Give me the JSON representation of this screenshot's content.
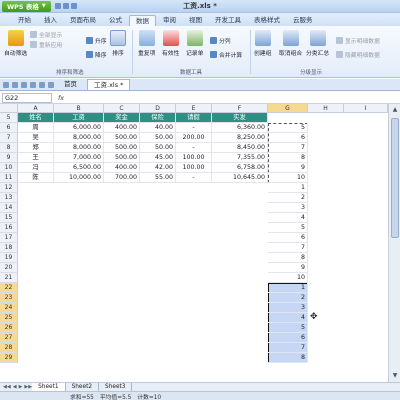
{
  "titlebar": {
    "app_button": "WPS 表格",
    "document_title": "工资.xls *"
  },
  "menu": {
    "tabs": [
      "开始",
      "插入",
      "页面布局",
      "公式",
      "数据",
      "审阅",
      "视图",
      "开发工具",
      "表格样式",
      "云服务"
    ],
    "active_index": 4
  },
  "ribbon": {
    "autofilter": "自动筛选",
    "show_all": "全部显示",
    "reapply": "重新应用",
    "sort_asc": "升序",
    "sort_desc": "降序",
    "sort": "排序",
    "highlight_dup": "重复项",
    "validity": "有效性",
    "records": "记录单",
    "split": "分列",
    "merge_calc": "合并计算",
    "create_group": "创建组",
    "ungroup": "取消组合",
    "subtotal": "分类汇总",
    "show_detail": "显示明细数据",
    "hide_detail": "隐藏明细数据",
    "group_sort_filter": "排序和筛选",
    "group_data_tools": "数据工具",
    "group_outline": "分级显示"
  },
  "doctabs": {
    "home_tab": "首页",
    "file_tab": "工资.xls *"
  },
  "formula_bar": {
    "namebox": "G22",
    "fx": "fx"
  },
  "columns": [
    "A",
    "B",
    "C",
    "D",
    "E",
    "F",
    "G",
    "H",
    "I"
  ],
  "selected_column": "G",
  "rows": {
    "numbers": [
      "5",
      "6",
      "7",
      "8",
      "9",
      "10",
      "11",
      "12",
      "13",
      "14",
      "15",
      "16",
      "17",
      "18",
      "19",
      "20",
      "21",
      "22",
      "23",
      "24",
      "25",
      "26",
      "27",
      "28",
      "29"
    ],
    "selected_numbers": [
      "22",
      "23",
      "24",
      "25",
      "26",
      "27",
      "28",
      "29"
    ]
  },
  "table": {
    "header": [
      "姓名",
      "工资",
      "奖金",
      "保险",
      "请假",
      "实发"
    ],
    "records": [
      {
        "name": "周",
        "salary": "6,000.00",
        "bonus": "400.00",
        "insurance": "40.00",
        "leave": "-",
        "net": "6,360.00"
      },
      {
        "name": "吴",
        "salary": "8,000.00",
        "bonus": "500.00",
        "insurance": "50.00",
        "leave": "200.00",
        "net": "8,250.00"
      },
      {
        "name": "郑",
        "salary": "8,000.00",
        "bonus": "500.00",
        "insurance": "50.00",
        "leave": "-",
        "net": "8,450.00"
      },
      {
        "name": "王",
        "salary": "7,000.00",
        "bonus": "500.00",
        "insurance": "45.00",
        "leave": "100.00",
        "net": "7,355.00"
      },
      {
        "name": "冯",
        "salary": "6,500.00",
        "bonus": "400.00",
        "insurance": "42.00",
        "leave": "100.00",
        "net": "6,758.00"
      },
      {
        "name": "陈",
        "salary": "10,000.00",
        "bonus": "700.00",
        "insurance": "55.00",
        "leave": "-",
        "net": "10,645.00"
      }
    ],
    "g_column": [
      "5",
      "6",
      "7",
      "8",
      "9",
      "10",
      "1",
      "2",
      "3",
      "4",
      "5",
      "6",
      "7",
      "8",
      "9",
      "10",
      "1",
      "2",
      "3",
      "4",
      "5",
      "6",
      "7",
      "8"
    ]
  },
  "sheets": [
    "Sheet1",
    "Sheet2",
    "Sheet3"
  ],
  "active_sheet": 0,
  "status": {
    "sum": "求和=55",
    "average": "平均值=5.5",
    "count": "计数=10"
  },
  "colors": {
    "header_fill": "#2f8f82",
    "selection_fill": "#c5d7f4",
    "selected_header": "#f7d991",
    "wps_green": "#4aa82a"
  }
}
